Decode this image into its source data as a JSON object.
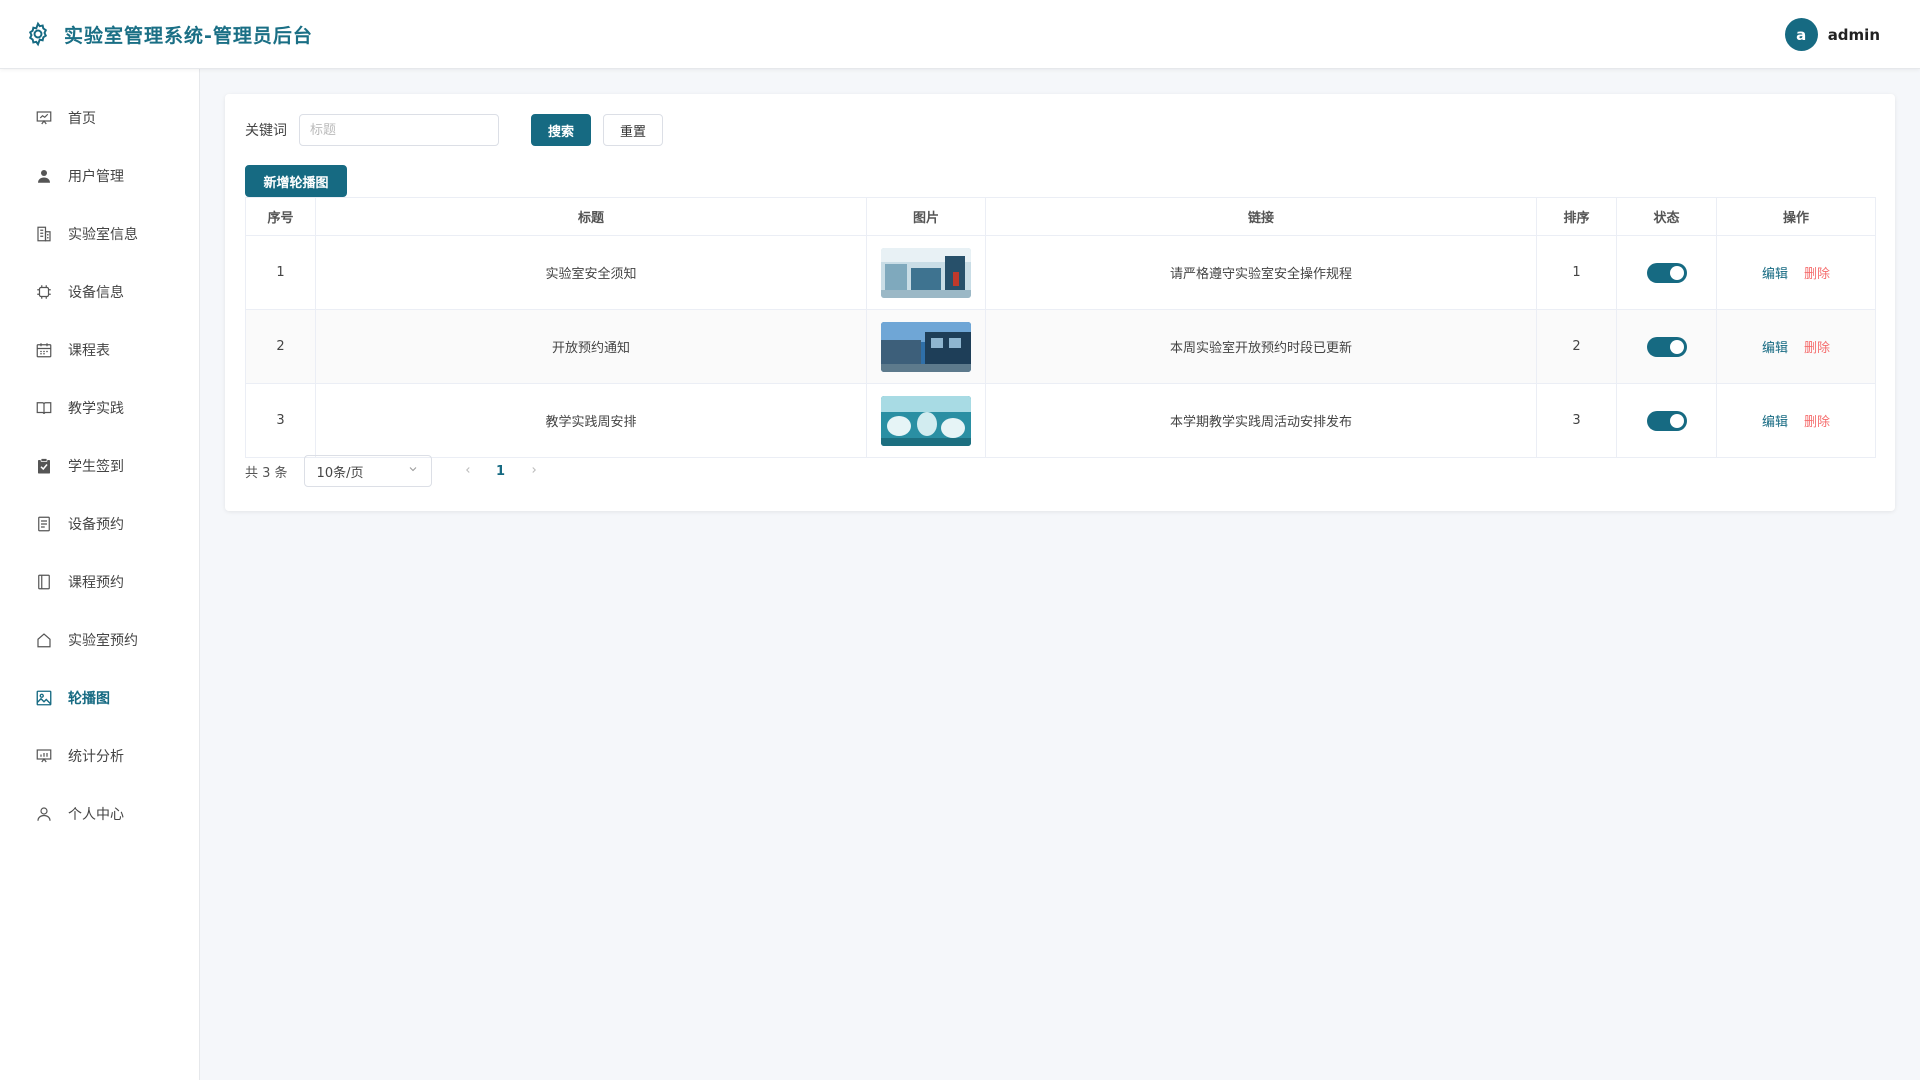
{
  "app": {
    "title": "实验室管理系统-管理员后台",
    "user_initial": "a",
    "username": "admin",
    "accent_color": "#166a82",
    "danger_color": "#f56c6c"
  },
  "sidebar": {
    "items": [
      {
        "label": "首页",
        "icon": "presentation-board-icon",
        "active": false
      },
      {
        "label": "用户管理",
        "icon": "user-icon",
        "active": false
      },
      {
        "label": "实验室信息",
        "icon": "building-icon",
        "active": false
      },
      {
        "label": "设备信息",
        "icon": "chip-icon",
        "active": false
      },
      {
        "label": "课程表",
        "icon": "calendar-icon",
        "active": false
      },
      {
        "label": "教学实践",
        "icon": "open-book-icon",
        "active": false
      },
      {
        "label": "学生签到",
        "icon": "clipboard-check-icon",
        "active": false
      },
      {
        "label": "设备预约",
        "icon": "document-icon",
        "active": false
      },
      {
        "label": "课程预约",
        "icon": "notebook-icon",
        "active": false
      },
      {
        "label": "实验室预约",
        "icon": "house-icon",
        "active": false
      },
      {
        "label": "轮播图",
        "icon": "image-icon",
        "active": true
      },
      {
        "label": "统计分析",
        "icon": "chart-board-icon",
        "active": false
      },
      {
        "label": "个人中心",
        "icon": "person-outline-icon",
        "active": false
      }
    ]
  },
  "search": {
    "keyword_label": "关键词",
    "placeholder": "标题",
    "value": "",
    "search_label": "搜索",
    "reset_label": "重置"
  },
  "toolbar": {
    "add_label": "新增轮播图"
  },
  "table": {
    "headers": {
      "index": "序号",
      "title": "标题",
      "image": "图片",
      "link": "链接",
      "order": "排序",
      "status": "状态",
      "actions": "操作"
    },
    "rows": [
      {
        "index": "1",
        "title": "实验室安全须知",
        "image_theme": "lab-interior",
        "link": "请严格遵守实验室安全操作规程",
        "order": "1",
        "status_on": true
      },
      {
        "index": "2",
        "title": "开放预约通知",
        "image_theme": "building-exterior",
        "link": "本周实验室开放预约时段已更新",
        "order": "2",
        "status_on": true
      },
      {
        "index": "3",
        "title": "教学实践周安排",
        "image_theme": "lab-practice",
        "link": "本学期教学实践周活动安排发布",
        "order": "3",
        "status_on": true
      }
    ],
    "edit_label": "编辑",
    "delete_label": "删除"
  },
  "pagination": {
    "total_text": "共 3 条",
    "page_size": "10条/页",
    "current_page": "1"
  }
}
